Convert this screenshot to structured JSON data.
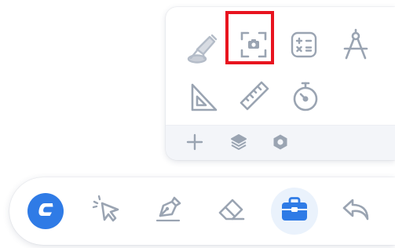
{
  "colors": {
    "icon_gray": "#9aa4b2",
    "accent_blue": "#2f7be6",
    "active_bg": "#eaf2fc",
    "highlight_red": "#e8141f",
    "panel_footer_bg": "#f3f5f9"
  },
  "tool_panel": {
    "tools": [
      {
        "icon": "spotlight-icon"
      },
      {
        "icon": "screenshot-icon",
        "highlighted": true
      },
      {
        "icon": "calculator-icon"
      },
      {
        "icon": "compass-icon"
      },
      {
        "icon": "set-square-icon"
      },
      {
        "icon": "ruler-icon"
      },
      {
        "icon": "stopwatch-icon"
      }
    ],
    "footer": [
      {
        "icon": "plus-icon"
      },
      {
        "icon": "layers-icon"
      },
      {
        "icon": "hexagon-icon"
      }
    ]
  },
  "toolbar": {
    "items": [
      {
        "icon": "app-logo-icon"
      },
      {
        "icon": "select-pointer-icon"
      },
      {
        "icon": "pen-icon"
      },
      {
        "icon": "eraser-icon"
      },
      {
        "icon": "toolbox-icon",
        "active": true
      },
      {
        "icon": "undo-icon"
      }
    ]
  }
}
